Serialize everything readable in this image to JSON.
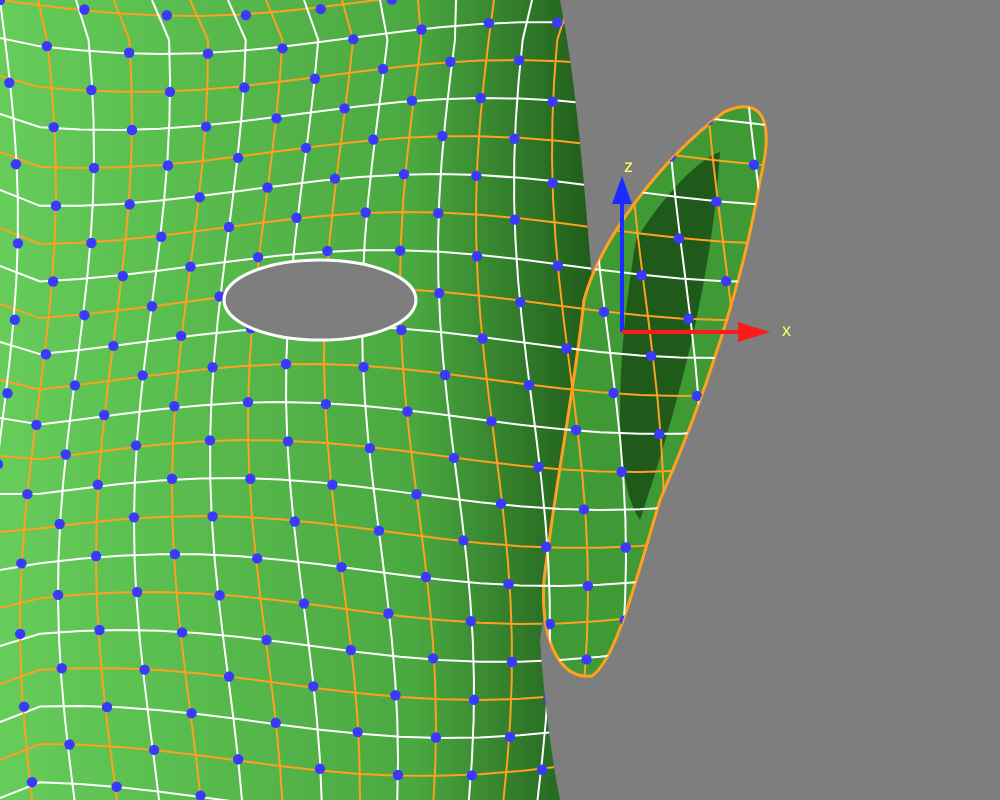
{
  "viewport": {
    "gizmo": {
      "axes": [
        {
          "kind": "vertical",
          "label": "z",
          "color": "#1a2cff"
        },
        {
          "kind": "horizontal",
          "label": "x",
          "color": "#ff1a1a"
        }
      ]
    }
  }
}
